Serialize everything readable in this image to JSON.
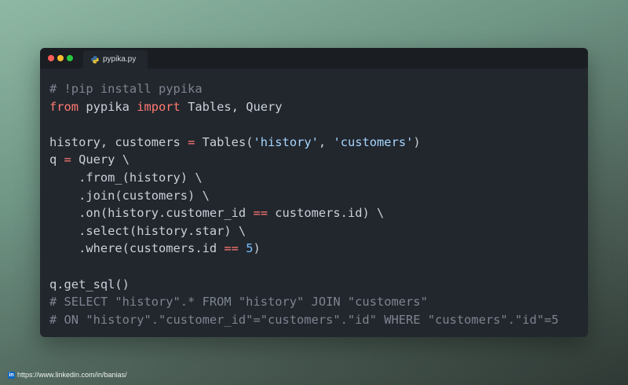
{
  "window": {
    "tab_label": "pypika.py",
    "tab_icon": "python-icon",
    "traffic_lights": {
      "close_color": "#ff5f57",
      "minimize_color": "#febc2e",
      "maximize_color": "#28c840"
    }
  },
  "colors": {
    "comment": "#7d8590",
    "keyword": "#ff7b72",
    "string": "#a5d6ff",
    "number": "#79c0ff",
    "text": "#c9d1d9",
    "editor_background": "#22262d"
  },
  "code_lines": [
    [
      {
        "t": "comment",
        "v": "# !pip install pypika"
      }
    ],
    [
      {
        "t": "keyword",
        "v": "from"
      },
      {
        "t": "plain",
        "v": " pypika "
      },
      {
        "t": "keyword",
        "v": "import"
      },
      {
        "t": "plain",
        "v": " Tables, Query"
      }
    ],
    [],
    [
      {
        "t": "plain",
        "v": "history, customers "
      },
      {
        "t": "operator",
        "v": "="
      },
      {
        "t": "plain",
        "v": " Tables("
      },
      {
        "t": "string",
        "v": "'history'"
      },
      {
        "t": "plain",
        "v": ", "
      },
      {
        "t": "string",
        "v": "'customers'"
      },
      {
        "t": "plain",
        "v": ")"
      }
    ],
    [
      {
        "t": "plain",
        "v": "q "
      },
      {
        "t": "operator",
        "v": "="
      },
      {
        "t": "plain",
        "v": " Query \\"
      }
    ],
    [
      {
        "t": "plain",
        "v": "    .from_(history) \\"
      }
    ],
    [
      {
        "t": "plain",
        "v": "    .join(customers) \\"
      }
    ],
    [
      {
        "t": "plain",
        "v": "    .on(history.customer_id "
      },
      {
        "t": "operator",
        "v": "=="
      },
      {
        "t": "plain",
        "v": " customers.id) \\"
      }
    ],
    [
      {
        "t": "plain",
        "v": "    .select(history.star) \\"
      }
    ],
    [
      {
        "t": "plain",
        "v": "    .where(customers.id "
      },
      {
        "t": "operator",
        "v": "=="
      },
      {
        "t": "plain",
        "v": " "
      },
      {
        "t": "number",
        "v": "5"
      },
      {
        "t": "plain",
        "v": ")"
      }
    ],
    [],
    [
      {
        "t": "plain",
        "v": "q.get_sql()"
      }
    ],
    [
      {
        "t": "comment",
        "v": "# SELECT \"history\".* FROM \"history\" JOIN \"customers\""
      }
    ],
    [
      {
        "t": "comment",
        "v": "# ON \"history\".\"customer_id\"=\"customers\".\"id\" WHERE \"customers\".\"id\"=5"
      }
    ]
  ],
  "footer": {
    "icon": "linkedin-icon",
    "icon_text": "in",
    "url": "https://www.linkedin.com/in/banias/"
  }
}
